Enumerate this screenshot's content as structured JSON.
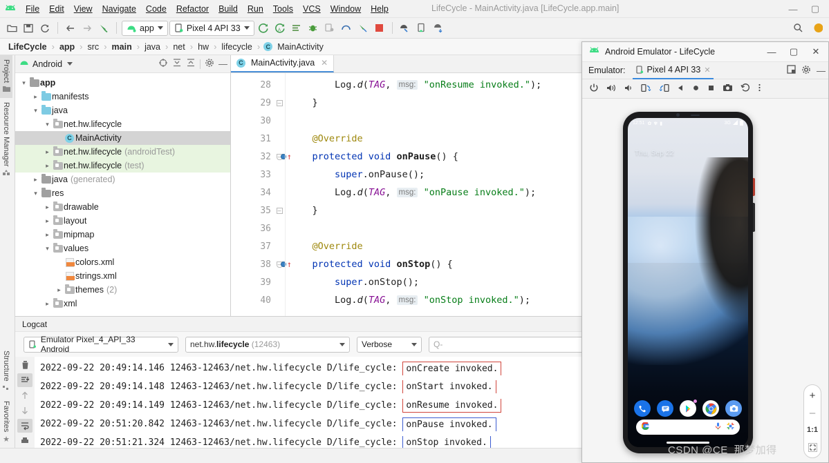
{
  "window": {
    "title": "LifeCycle - MainActivity.java [LifeCycle.app.main]",
    "minimize": "—",
    "maximize": "▢",
    "close": "✕"
  },
  "menu": {
    "items": [
      "File",
      "Edit",
      "View",
      "Navigate",
      "Code",
      "Refactor",
      "Build",
      "Run",
      "Tools",
      "VCS",
      "Window",
      "Help"
    ]
  },
  "toolbar": {
    "module_selector": "app",
    "device_selector": "Pixel 4 API 33",
    "icons": [
      "open-folder-icon",
      "save-icon",
      "sync-icon",
      "back-arrow-icon",
      "forward-arrow-icon",
      "build-hammer-icon"
    ],
    "run_icons": [
      "run-icon",
      "debug-run-icon",
      "apply-changes-icon",
      "debug-bug-icon",
      "attach-debugger-icon",
      "profiler-icon",
      "sdk-icon",
      "stop-icon"
    ],
    "right_icons": [
      "avd-manager-icon",
      "sdk-manager-icon",
      "device-file-explorer-icon",
      "search-icon",
      "notification-icon"
    ]
  },
  "breadcrumb": {
    "items": [
      {
        "label": "LifeCycle",
        "bold": true
      },
      {
        "label": "app",
        "bold": true
      },
      {
        "label": "src",
        "bold": false
      },
      {
        "label": "main",
        "bold": true
      },
      {
        "label": "java",
        "bold": false
      },
      {
        "label": "net",
        "bold": false
      },
      {
        "label": "hw",
        "bold": false
      },
      {
        "label": "lifecycle",
        "bold": false
      },
      {
        "label": "MainActivity",
        "bold": false,
        "icon": "class-icon"
      }
    ]
  },
  "rail": {
    "top": [
      "Project",
      "Resource Manager"
    ],
    "bottom": [
      "Structure",
      "Favorites"
    ]
  },
  "project_panel": {
    "title": "Android",
    "header_icons": [
      "select-opened-file-icon",
      "expand-all-icon",
      "collapse-all-icon",
      "settings-gear-icon",
      "hide-icon"
    ],
    "tree": [
      {
        "depth": 0,
        "twisty": "v",
        "icon": "module-folder",
        "label": "app",
        "bold": true,
        "sub": "",
        "state": "normal"
      },
      {
        "depth": 1,
        "twisty": ">",
        "icon": "folder",
        "label": "manifests",
        "bold": false,
        "sub": "",
        "state": "normal"
      },
      {
        "depth": 1,
        "twisty": "v",
        "icon": "folder",
        "label": "java",
        "bold": false,
        "sub": "",
        "state": "normal"
      },
      {
        "depth": 2,
        "twisty": "v",
        "icon": "package",
        "label": "net.hw.lifecycle",
        "bold": false,
        "sub": "",
        "state": "normal"
      },
      {
        "depth": 3,
        "twisty": "",
        "icon": "class",
        "label": "MainActivity",
        "bold": false,
        "sub": "",
        "state": "selected"
      },
      {
        "depth": 2,
        "twisty": ">",
        "icon": "package",
        "label": "net.hw.lifecycle",
        "bold": false,
        "sub": "(androidTest)",
        "state": "green"
      },
      {
        "depth": 2,
        "twisty": ">",
        "icon": "package",
        "label": "net.hw.lifecycle",
        "bold": false,
        "sub": "(test)",
        "state": "green"
      },
      {
        "depth": 1,
        "twisty": ">",
        "icon": "folder-gen",
        "label": "java",
        "bold": false,
        "sub": "(generated)",
        "state": "normal"
      },
      {
        "depth": 1,
        "twisty": "v",
        "icon": "folder-res",
        "label": "res",
        "bold": false,
        "sub": "",
        "state": "normal"
      },
      {
        "depth": 2,
        "twisty": ">",
        "icon": "package",
        "label": "drawable",
        "bold": false,
        "sub": "",
        "state": "normal"
      },
      {
        "depth": 2,
        "twisty": ">",
        "icon": "package",
        "label": "layout",
        "bold": false,
        "sub": "",
        "state": "normal"
      },
      {
        "depth": 2,
        "twisty": ">",
        "icon": "package",
        "label": "mipmap",
        "bold": false,
        "sub": "",
        "state": "normal"
      },
      {
        "depth": 2,
        "twisty": "v",
        "icon": "package",
        "label": "values",
        "bold": false,
        "sub": "",
        "state": "normal"
      },
      {
        "depth": 3,
        "twisty": "",
        "icon": "xml",
        "label": "colors.xml",
        "bold": false,
        "sub": "",
        "state": "normal"
      },
      {
        "depth": 3,
        "twisty": "",
        "icon": "xml",
        "label": "strings.xml",
        "bold": false,
        "sub": "",
        "state": "normal"
      },
      {
        "depth": 3,
        "twisty": ">",
        "icon": "package",
        "label": "themes",
        "bold": false,
        "sub": "(2)",
        "state": "normal"
      },
      {
        "depth": 2,
        "twisty": ">",
        "icon": "package",
        "label": "xml",
        "bold": false,
        "sub": "",
        "state": "normal"
      }
    ]
  },
  "editor": {
    "tab": "MainActivity.java",
    "tab_close": "✕",
    "lines": [
      {
        "n": "28",
        "fold": "",
        "bp": false,
        "tokens": [
          {
            "t": "        ",
            "c": ""
          },
          {
            "t": "Log",
            "c": "idn"
          },
          {
            "t": ".",
            "c": "idn"
          },
          {
            "t": "d",
            "c": "mth-i"
          },
          {
            "t": "(",
            "c": "idn"
          },
          {
            "t": "TAG",
            "c": "fld"
          },
          {
            "t": ", ",
            "c": "idn"
          },
          {
            "t": "msg:",
            "c": "hint"
          },
          {
            "t": " ",
            "c": ""
          },
          {
            "t": "\"onResume invoked.\"",
            "c": "str"
          },
          {
            "t": ");",
            "c": "idn"
          }
        ]
      },
      {
        "n": "29",
        "fold": "minus",
        "bp": false,
        "tokens": [
          {
            "t": "    }",
            "c": "idn"
          }
        ]
      },
      {
        "n": "30",
        "fold": "",
        "bp": false,
        "tokens": []
      },
      {
        "n": "31",
        "fold": "",
        "bp": false,
        "tokens": [
          {
            "t": "    @Override",
            "c": "ann"
          }
        ]
      },
      {
        "n": "32",
        "fold": "round",
        "bp": true,
        "tokens": [
          {
            "t": "    ",
            "c": ""
          },
          {
            "t": "protected void",
            "c": "kw"
          },
          {
            "t": " ",
            "c": ""
          },
          {
            "t": "onPause",
            "c": "mth"
          },
          {
            "t": "() {",
            "c": "idn"
          }
        ]
      },
      {
        "n": "33",
        "fold": "",
        "bp": false,
        "tokens": [
          {
            "t": "        ",
            "c": ""
          },
          {
            "t": "super",
            "c": "kw"
          },
          {
            "t": ".onPause();",
            "c": "idn"
          }
        ]
      },
      {
        "n": "34",
        "fold": "",
        "bp": false,
        "tokens": [
          {
            "t": "        ",
            "c": ""
          },
          {
            "t": "Log",
            "c": "idn"
          },
          {
            "t": ".",
            "c": "idn"
          },
          {
            "t": "d",
            "c": "mth-i"
          },
          {
            "t": "(",
            "c": "idn"
          },
          {
            "t": "TAG",
            "c": "fld"
          },
          {
            "t": ", ",
            "c": "idn"
          },
          {
            "t": "msg:",
            "c": "hint"
          },
          {
            "t": " ",
            "c": ""
          },
          {
            "t": "\"onPause invoked.\"",
            "c": "str"
          },
          {
            "t": ");",
            "c": "idn"
          }
        ]
      },
      {
        "n": "35",
        "fold": "minus",
        "bp": false,
        "tokens": [
          {
            "t": "    }",
            "c": "idn"
          }
        ]
      },
      {
        "n": "36",
        "fold": "",
        "bp": false,
        "tokens": []
      },
      {
        "n": "37",
        "fold": "",
        "bp": false,
        "tokens": [
          {
            "t": "    @Override",
            "c": "ann"
          }
        ]
      },
      {
        "n": "38",
        "fold": "round",
        "bp": true,
        "tokens": [
          {
            "t": "    ",
            "c": ""
          },
          {
            "t": "protected void",
            "c": "kw"
          },
          {
            "t": " ",
            "c": ""
          },
          {
            "t": "onStop",
            "c": "mth"
          },
          {
            "t": "() {",
            "c": "idn"
          }
        ]
      },
      {
        "n": "39",
        "fold": "",
        "bp": false,
        "tokens": [
          {
            "t": "        ",
            "c": ""
          },
          {
            "t": "super",
            "c": "kw"
          },
          {
            "t": ".onStop();",
            "c": "idn"
          }
        ]
      },
      {
        "n": "40",
        "fold": "",
        "bp": false,
        "tokens": [
          {
            "t": "        ",
            "c": ""
          },
          {
            "t": "Log",
            "c": "idn"
          },
          {
            "t": ".",
            "c": "idn"
          },
          {
            "t": "d",
            "c": "mth-i"
          },
          {
            "t": "(",
            "c": "idn"
          },
          {
            "t": "TAG",
            "c": "fld"
          },
          {
            "t": ", ",
            "c": "idn"
          },
          {
            "t": "msg:",
            "c": "hint"
          },
          {
            "t": " ",
            "c": ""
          },
          {
            "t": "\"onStop invoked.\"",
            "c": "str"
          },
          {
            "t": ");",
            "c": "idn"
          }
        ]
      }
    ]
  },
  "logcat": {
    "title": "Logcat",
    "device": "Emulator Pixel_4_API_33 Android",
    "process": "net.hw.lifecycle",
    "process_pid": "(12463)",
    "level": "Verbose",
    "search_placeholder": "Q-",
    "rail_icons": [
      "clear-logcat-icon",
      "scroll-to-end-icon",
      "up-arrow-icon",
      "down-arrow-icon",
      "soft-wrap-icon",
      "print-icon"
    ],
    "rows": [
      {
        "prefix": "2022-09-22 20:49:14.146 12463-12463/net.hw.lifecycle D/life_cycle: ",
        "message": "onCreate invoked.",
        "box": "red-top"
      },
      {
        "prefix": "2022-09-22 20:49:14.148 12463-12463/net.hw.lifecycle D/life_cycle: ",
        "message": "onStart invoked.",
        "box": "red-mid"
      },
      {
        "prefix": "2022-09-22 20:49:14.149 12463-12463/net.hw.lifecycle D/life_cycle: ",
        "message": "onResume invoked.",
        "box": "red-bot"
      },
      {
        "prefix": "2022-09-22 20:51:20.842 12463-12463/net.hw.lifecycle D/life_cycle: ",
        "message": "onPause invoked.",
        "box": "blue-top"
      },
      {
        "prefix": "2022-09-22 20:51:21.324 12463-12463/net.hw.lifecycle D/life_cycle: ",
        "message": "onStop invoked.",
        "box": "blue-bot"
      }
    ]
  },
  "emulator": {
    "title": "Android Emulator - LifeCycle",
    "minimize": "—",
    "maximize": "▢",
    "close": "✕",
    "tab_label": "Emulator:",
    "device_tab": "Pixel 4 API 33",
    "device_tab_close": "✕",
    "header_icons": [
      "snapshot-icon",
      "settings-gear-icon",
      "hide-icon"
    ],
    "controls": [
      "power-icon",
      "volume-up-icon",
      "volume-down-icon",
      "rotate-left-icon",
      "rotate-right-icon",
      "back-icon",
      "home-icon",
      "overview-icon",
      "screenshot-icon",
      "history-icon",
      "more-icon"
    ],
    "side_tools": [
      "+",
      "–",
      "1:1",
      "fit-screen-icon"
    ],
    "phone": {
      "status_time": "12:51",
      "status_icons": [
        "settings-icon",
        "sync-icon",
        "battery-saver-icon"
      ],
      "network": "3G",
      "signal_icon": "signal-icon",
      "battery_icon": "battery-icon",
      "date": "Thu, Sep 22",
      "dock_apps": [
        "phone-icon",
        "messages-icon",
        "play-store-icon",
        "chrome-icon",
        "camera-icon"
      ],
      "search_left_icon": "google-g-icon",
      "search_mic_icon": "microphone-icon",
      "search_lens_icon": "google-lens-icon"
    }
  },
  "watermark": "CSDN @CE_那梦加得"
}
